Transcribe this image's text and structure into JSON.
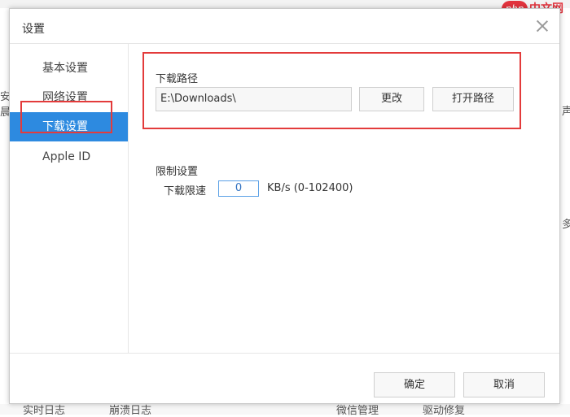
{
  "background": {
    "left_fragment_1": "安",
    "left_fragment_2": "晨",
    "right_fragment_1": "声",
    "right_fragment_2": "多",
    "bottom_items": [
      "实时日志",
      "崩溃日志",
      "微信管理",
      "驱动修复"
    ]
  },
  "watermark": {
    "brand": "php",
    "suffix": "中文网"
  },
  "dialog": {
    "title": "设置",
    "sidebar": {
      "items": [
        {
          "label": "基本设置",
          "active": false
        },
        {
          "label": "网络设置",
          "active": false
        },
        {
          "label": "下载设置",
          "active": true
        },
        {
          "label": "Apple ID",
          "active": false
        }
      ]
    },
    "download_path": {
      "section_title": "下载路径",
      "path_value": "E:\\Downloads\\",
      "change_button": "更改",
      "open_button": "打开路径"
    },
    "limits": {
      "section_title": "限制设置",
      "speed_label": "下载限速",
      "speed_value": "0",
      "speed_unit": "KB/s (0-102400)"
    },
    "footer": {
      "ok_button": "确定",
      "cancel_button": "取消"
    }
  },
  "colors": {
    "accent": "#2d8ae0",
    "highlight_border": "#e33b3b",
    "brand": "#e2343e"
  }
}
